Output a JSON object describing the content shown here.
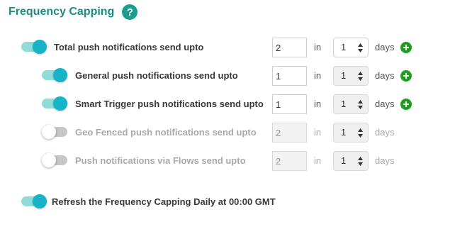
{
  "header": {
    "title": "Frequency Capping",
    "help_glyph": "?"
  },
  "rows": [
    {
      "label": "Total push notifications send upto",
      "enabled": true,
      "count": "2",
      "in_label": "in",
      "days_value": "1",
      "days_label": "days",
      "can_add": true
    },
    {
      "label": "General push notifications send upto",
      "enabled": true,
      "count": "1",
      "in_label": "in",
      "days_value": "1",
      "days_label": "days",
      "can_add": true
    },
    {
      "label": "Smart Trigger push notifications send upto",
      "enabled": true,
      "count": "1",
      "in_label": "in",
      "days_value": "1",
      "days_label": "days",
      "can_add": true
    },
    {
      "label": "Geo Fenced push notifications send upto",
      "enabled": false,
      "count": "2",
      "in_label": "in",
      "days_value": "1",
      "days_label": "days",
      "can_add": false
    },
    {
      "label": "Push notifications via Flows send upto",
      "enabled": false,
      "count": "2",
      "in_label": "in",
      "days_value": "1",
      "days_label": "days",
      "can_add": false
    }
  ],
  "refresh": {
    "label": "Refresh the Frequency Capping Daily at 00:00 GMT",
    "enabled": true
  },
  "colors": {
    "accent": "#1a8d82",
    "toggle_on": "#17b3c9",
    "add": "#1f9e1c"
  },
  "icons": {
    "help": "help-icon",
    "add": "plus-circle-icon",
    "select_arrows": "up-down-arrows-icon"
  }
}
